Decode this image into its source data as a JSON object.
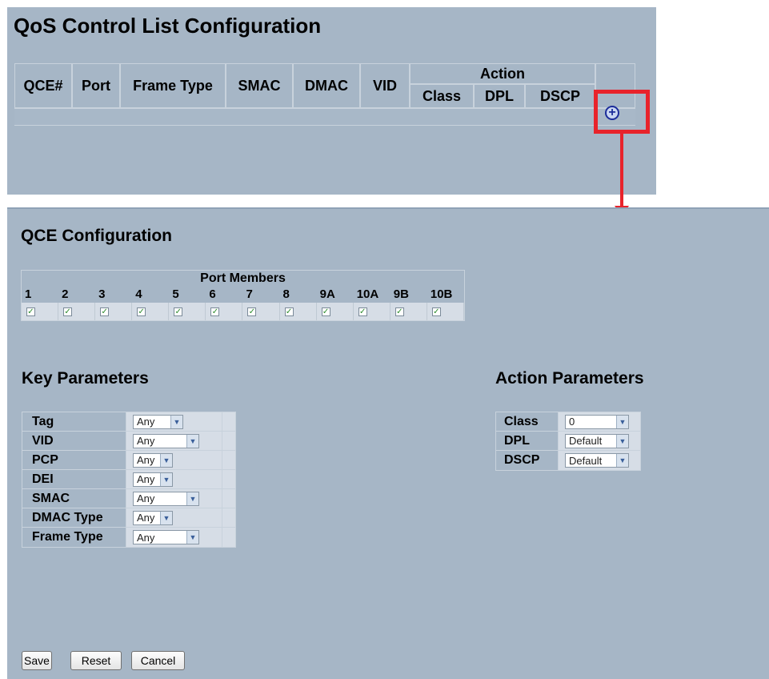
{
  "qcl": {
    "title": "QoS Control List Configuration",
    "columns": [
      "QCE#",
      "Port",
      "Frame Type",
      "SMAC",
      "DMAC",
      "VID"
    ],
    "action_group": "Action",
    "action_columns": [
      "Class",
      "DPL",
      "DSCP"
    ],
    "add_icon": "add-circle-icon",
    "highlight_color": "#e8232b"
  },
  "qce": {
    "title": "QCE Configuration",
    "port_members_header": "Port Members",
    "ports": [
      "1",
      "2",
      "3",
      "4",
      "5",
      "6",
      "7",
      "8",
      "9A",
      "10A",
      "9B",
      "10B"
    ],
    "checked_mark": "✓"
  },
  "key_parameters": {
    "title": "Key Parameters",
    "rows": [
      {
        "label": "Tag",
        "value": "Any"
      },
      {
        "label": "VID",
        "value": "Any"
      },
      {
        "label": "PCP",
        "value": "Any"
      },
      {
        "label": "DEI",
        "value": "Any"
      },
      {
        "label": "SMAC",
        "value": "Any"
      },
      {
        "label": "DMAC Type",
        "value": "Any"
      },
      {
        "label": "Frame Type",
        "value": "Any"
      }
    ]
  },
  "action_parameters": {
    "title": "Action Parameters",
    "rows": [
      {
        "label": "Class",
        "value": "0"
      },
      {
        "label": "DPL",
        "value": "Default"
      },
      {
        "label": "DSCP",
        "value": "Default"
      }
    ]
  },
  "buttons": {
    "save": "Save",
    "reset": "Reset",
    "cancel": "Cancel"
  },
  "colors": {
    "panel": "#a6b6c6",
    "accent_red": "#e8232b",
    "add_icon_blue": "#1b2c9a"
  }
}
